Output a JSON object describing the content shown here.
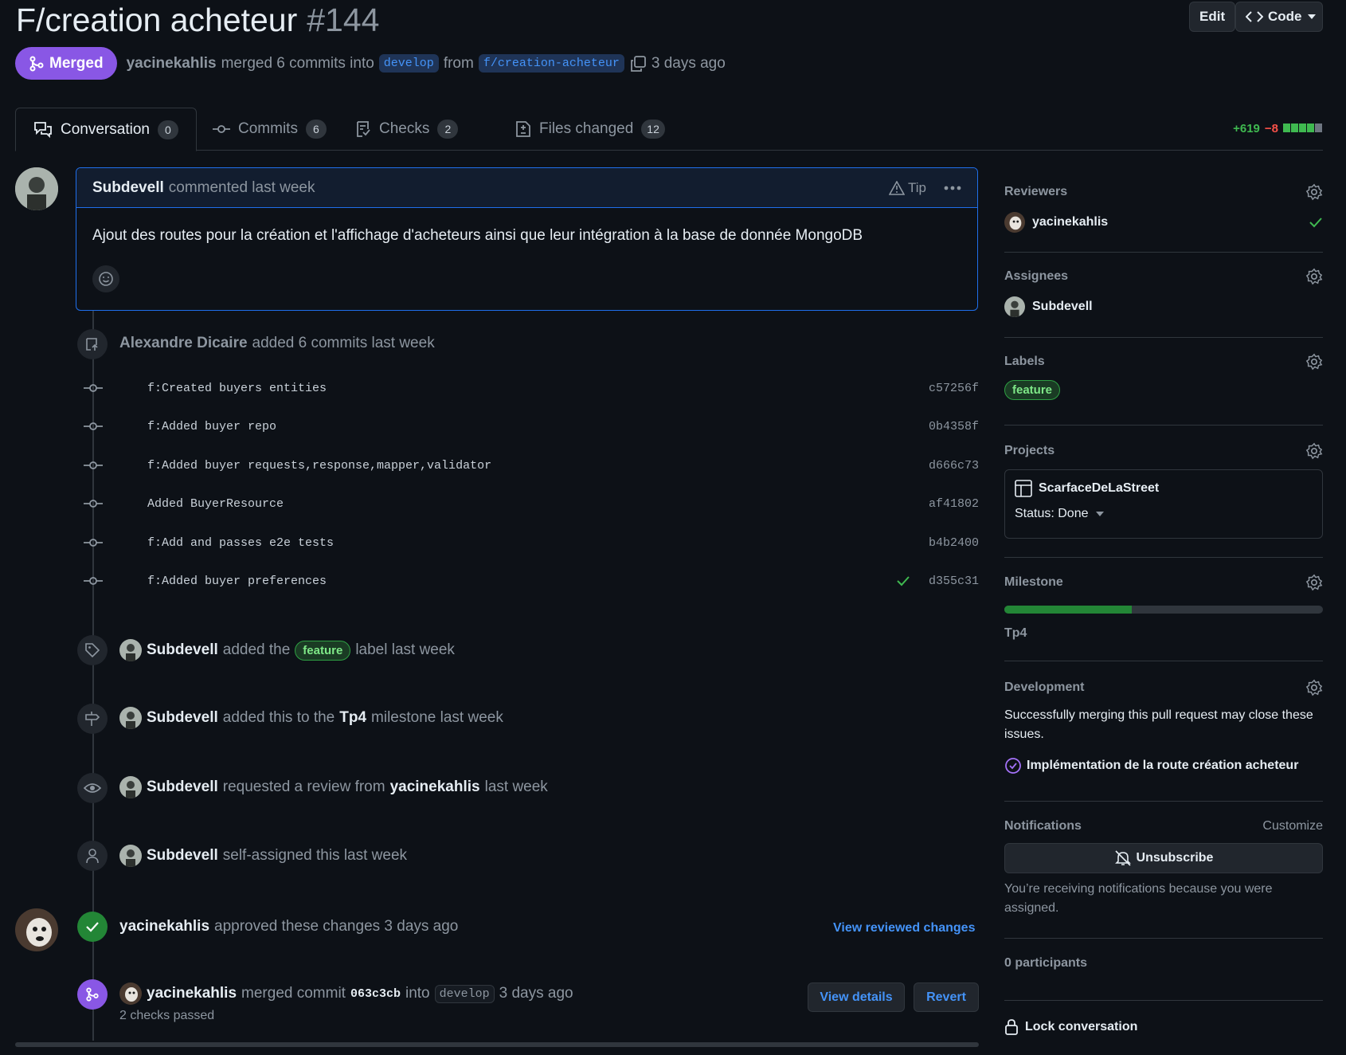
{
  "pr": {
    "title": "F/creation acheteur",
    "number": "#144",
    "state": "Merged",
    "author": "yacinekahlis",
    "merge_text": "merged 6 commits into",
    "base": "develop",
    "from_text": "from",
    "head": "f/creation-acheteur",
    "time": "3 days ago"
  },
  "header_buttons": {
    "edit": "Edit",
    "code": "Code"
  },
  "tabs": [
    {
      "label": "Conversation",
      "count": "0"
    },
    {
      "label": "Commits",
      "count": "6"
    },
    {
      "label": "Checks",
      "count": "2"
    },
    {
      "label": "Files changed",
      "count": "12"
    }
  ],
  "diffstat": {
    "additions": "+619",
    "deletions": "−8"
  },
  "comment": {
    "author": "Subdevell",
    "meta": "commented last week",
    "tip": "Tip",
    "body": "Ajout des routes pour la création et l'affichage d'acheteurs ainsi que leur intégration à la base de donnée MongoDB"
  },
  "commits_event": {
    "author": "Alexandre Dicaire",
    "text": "added 6 commits last week"
  },
  "commits": [
    {
      "msg": "f:Created buyers entities",
      "sha": "c57256f"
    },
    {
      "msg": "f:Added buyer repo",
      "sha": "0b4358f"
    },
    {
      "msg": "f:Added buyer requests,response,mapper,validator",
      "sha": "d666c73"
    },
    {
      "msg": "Added BuyerResource",
      "sha": "af41802"
    },
    {
      "msg": "f:Add and passes e2e tests",
      "sha": "b4b2400"
    },
    {
      "msg": "f:Added buyer preferences",
      "sha": "d355c31"
    }
  ],
  "events": {
    "label": {
      "actor": "Subdevell",
      "pre": "added the",
      "label": "feature",
      "post": "label last week"
    },
    "milestone": {
      "actor": "Subdevell",
      "pre": "added this to the",
      "milestone": "Tp4",
      "post": "milestone last week"
    },
    "review_req": {
      "actor": "Subdevell",
      "pre": "requested a review from",
      "reviewer": "yacinekahlis",
      "post": "last week"
    },
    "assigned": {
      "actor": "Subdevell",
      "text": "self-assigned this last week"
    },
    "approved": {
      "actor": "yacinekahlis",
      "text": "approved these changes 3 days ago",
      "link": "View reviewed changes"
    },
    "merged": {
      "actor": "yacinekahlis",
      "pre": "merged commit",
      "sha": "063c3cb",
      "into": "into",
      "base": "develop",
      "time": "3 days ago",
      "checks": "2 checks passed",
      "view_details": "View details",
      "revert": "Revert"
    }
  },
  "sidebar": {
    "reviewers": {
      "title": "Reviewers",
      "user": "yacinekahlis"
    },
    "assignees": {
      "title": "Assignees",
      "user": "Subdevell"
    },
    "labels": {
      "title": "Labels",
      "label": "feature"
    },
    "projects": {
      "title": "Projects",
      "project": "ScarfaceDeLaStreet",
      "status": "Status: Done"
    },
    "milestone": {
      "title": "Milestone",
      "name": "Tp4",
      "progress_percent": 40
    },
    "development": {
      "title": "Development",
      "text": "Successfully merging this pull request may close these issues.",
      "issue": "Implémentation de la route création acheteur"
    },
    "notifications": {
      "title": "Notifications",
      "customize": "Customize",
      "button": "Unsubscribe",
      "reason": "You’re receiving notifications because you were assigned."
    },
    "participants": "0 participants",
    "lock": "Lock conversation"
  },
  "colors": {
    "merged": "#8957e5",
    "green": "#3fb950",
    "link": "#4493f8",
    "bg": "#0d1117"
  }
}
